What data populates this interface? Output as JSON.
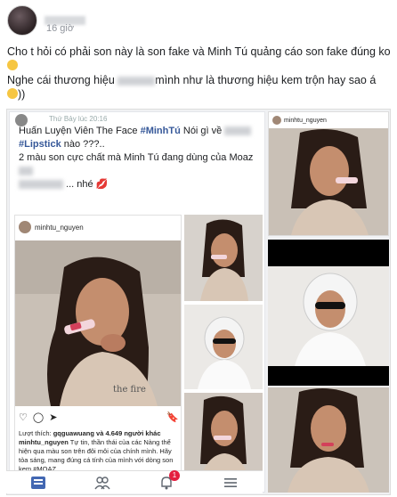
{
  "post": {
    "time": "16 giờ",
    "caption_line1": "Cho t hỏi có phải son này là son fake và Minh Tú quảng cáo son fake đúng ko",
    "caption_line2_a": "Nghe cái thương hiệu",
    "caption_line2_b": "mình như là thương hiệu kem trộn hay sao á",
    "caption_line3": "))"
  },
  "inner_post": {
    "time": "Thứ Bảy lúc 20:16",
    "line1_a": "Huấn Luyện Viên The Face",
    "line1_hash": "#MinhTú",
    "line1_b": "Nói gì về",
    "line2_hash": "#Lipstick",
    "line2_b": "nào ???..",
    "line3": "2 màu son cực chất mà Minh Tú đang dùng  của Moaz",
    "line5": "... nhé"
  },
  "instagram": {
    "username": "minhtu_nguyen",
    "likes": "gqguawuang và 4.649 người khác",
    "caption_user": "minhtu_nguyen",
    "caption_text": "Tự tin, thần thái của các Nàng thể hiện qua màu son trên đôi môi của chính mình. Hãy tỏa sáng, mang đúng cá tính của mình với dòng son kem #MOAZ",
    "liked_by_prefix": "Lượt thích:"
  },
  "side_card": {
    "username": "minhtu_nguyen"
  },
  "nav": {
    "badge_count": "1"
  },
  "colors": {
    "link": "#365899",
    "badge": "#e41e3f",
    "nav_active": "#4267b2"
  }
}
